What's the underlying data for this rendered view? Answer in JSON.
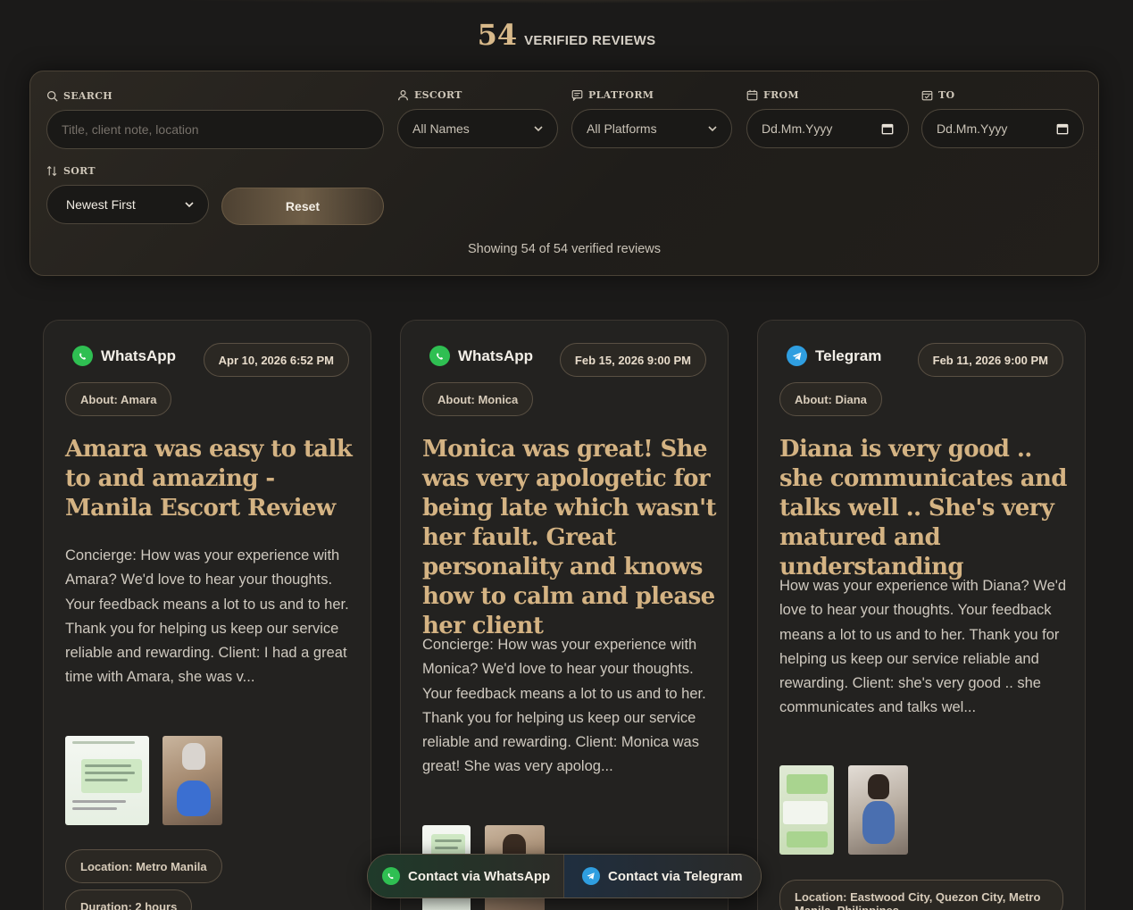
{
  "header": {
    "count": "54",
    "label": "VERIFIED REVIEWS"
  },
  "filters": {
    "search": {
      "label": "SEARCH",
      "placeholder": "Title, client note, location"
    },
    "escort": {
      "label": "ESCORT",
      "value": "All Names"
    },
    "platform": {
      "label": "PLATFORM",
      "value": "All Platforms"
    },
    "from": {
      "label": "FROM",
      "value": "Dd.Mm.Yyyy"
    },
    "to": {
      "label": "TO",
      "value": "Dd.Mm.Yyyy"
    },
    "sort": {
      "label": "SORT",
      "value": "Newest First"
    },
    "reset_label": "Reset",
    "showing": "Showing 54 of 54 verified reviews"
  },
  "cards": [
    {
      "platform": "WhatsApp",
      "date": "Apr 10, 2026 6:52 PM",
      "about": "About: Amara",
      "title": "Amara was easy to talk to and amazing - Manila Escort Review",
      "body": "Concierge: How was your experience with Amara? We'd love to hear your thoughts. Your feedback means a lot to us and to her. Thank you for helping us keep our service reliable and rewarding. Client: I had a great time with Amara, she was v...",
      "chips": [
        "Location: Metro Manila",
        "Duration: 2 hours"
      ]
    },
    {
      "platform": "WhatsApp",
      "date": "Feb 15, 2026 9:00 PM",
      "about": "About: Monica",
      "title": "Monica was great! She was very apologetic for being late which wasn't her fault. Great personality and knows how to calm and please her client",
      "body": "Concierge: How was your experience with Monica? We'd love to hear your thoughts. Your feedback means a lot to us and to her. Thank you for helping us keep our service reliable and rewarding. Client: Monica was great! She was very apolog...",
      "chips": []
    },
    {
      "platform": "Telegram",
      "date": "Feb 11, 2026 9:00 PM",
      "about": "About: Diana",
      "title": "Diana is very good .. she communicates and talks well .. She's very matured and understanding",
      "body": "How was your experience with Diana? We'd love to hear your thoughts. Your feedback means a lot to us and to her. Thank you for helping us keep our service reliable and rewarding. Client: she's very good .. she communicates and talks wel...",
      "chips": [
        "Location: Eastwood City, Quezon City, Metro Manila, Philippines"
      ]
    }
  ],
  "contact": {
    "whatsapp": "Contact via WhatsApp",
    "telegram": "Contact via Telegram"
  }
}
